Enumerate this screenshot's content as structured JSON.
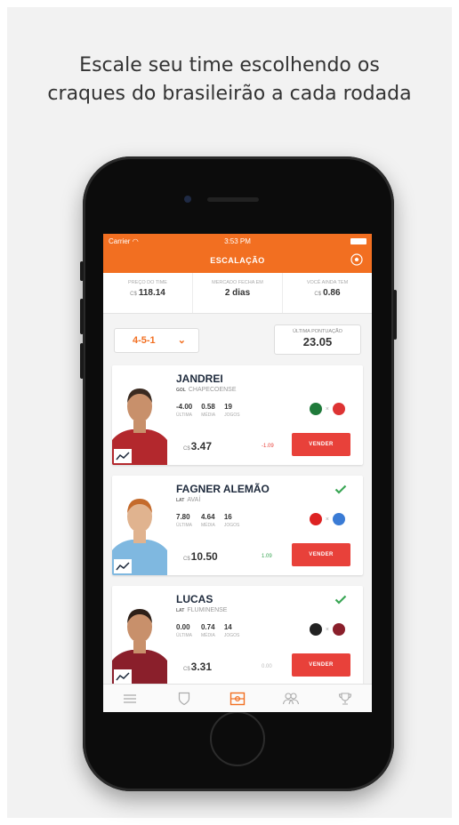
{
  "headline": {
    "line1": "Escale seu time escolhendo os",
    "line2": "craques do brasileirão a cada rodada"
  },
  "statusbar": {
    "carrier": "Carrier",
    "time": "3:53 PM"
  },
  "navbar": {
    "title": "ESCALAÇÃO",
    "right_icon": "soccer-ball-icon"
  },
  "summary": [
    {
      "label": "PREÇO DO TIME",
      "currency": "C$",
      "value": "118.14"
    },
    {
      "label": "MERCADO FECHA EM",
      "currency": "",
      "value": "2 dias"
    },
    {
      "label": "VOCÊ AINDA TEM",
      "currency": "C$",
      "value": "0.86"
    }
  ],
  "formation": {
    "value": "4-5-1"
  },
  "last_score": {
    "label": "ÚLTIMA PONTUAÇÃO",
    "value": "23.05"
  },
  "players": [
    {
      "name": "JANDREI",
      "position": "GOL",
      "club": "CHAPECOENSE",
      "stats": [
        {
          "n": "-4.00",
          "l": "ÚLTIMA"
        },
        {
          "n": "0.58",
          "l": "MÉDIA"
        },
        {
          "n": "19",
          "l": "JOGOS"
        }
      ],
      "currency": "C$",
      "price": "3.47",
      "variation": "-1.09",
      "variation_color": "#e8413a",
      "checked": false,
      "sell_label": "VENDER",
      "jersey": "#b3282d",
      "skin": "#c8906b",
      "hair": "#3a2a20",
      "home_crest": "#1f7a3a",
      "away_crest": "#d33"
    },
    {
      "name": "FAGNER ALEMÃO",
      "position": "LAT",
      "club": "AVAÍ",
      "stats": [
        {
          "n": "7.80",
          "l": "ÚLTIMA"
        },
        {
          "n": "4.64",
          "l": "MÉDIA"
        },
        {
          "n": "16",
          "l": "JOGOS"
        }
      ],
      "currency": "C$",
      "price": "10.50",
      "variation": "1.09",
      "variation_color": "#3aa655",
      "checked": true,
      "sell_label": "VENDER",
      "jersey": "#7fb8e0",
      "skin": "#e0b38f",
      "hair": "#c46a2b",
      "home_crest": "#d22",
      "away_crest": "#3a7bd5"
    },
    {
      "name": "LUCAS",
      "position": "LAT",
      "club": "FLUMINENSE",
      "stats": [
        {
          "n": "0.00",
          "l": "ÚLTIMA"
        },
        {
          "n": "0.74",
          "l": "MÉDIA"
        },
        {
          "n": "14",
          "l": "JOGOS"
        }
      ],
      "currency": "C$",
      "price": "3.31",
      "variation": "0.00",
      "variation_color": "#bbbbbb",
      "checked": true,
      "sell_label": "VENDER",
      "jersey": "#8a1f2b",
      "skin": "#c8906b",
      "hair": "#2e2018",
      "home_crest": "#222",
      "away_crest": "#8a1f2b"
    }
  ],
  "tabs": [
    {
      "name": "menu-icon",
      "active": false
    },
    {
      "name": "shield-icon",
      "active": false
    },
    {
      "name": "field-icon",
      "active": true
    },
    {
      "name": "users-icon",
      "active": false
    },
    {
      "name": "trophy-icon",
      "active": false
    }
  ],
  "colors": {
    "accent": "#f26f21",
    "sell": "#e8413a",
    "check": "#3aa655"
  }
}
